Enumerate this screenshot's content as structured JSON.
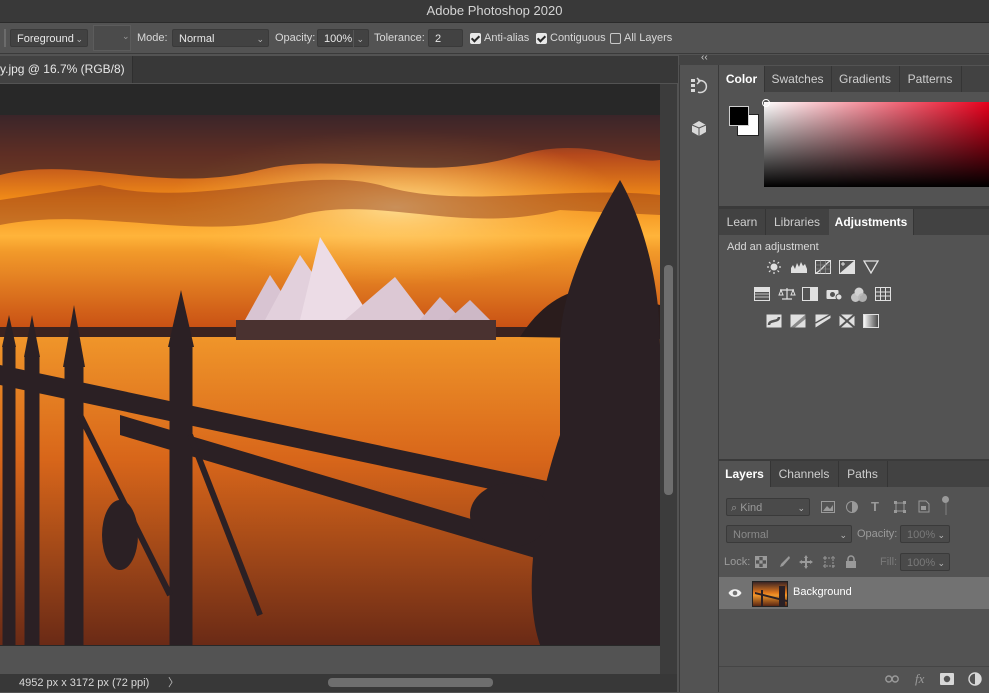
{
  "app_title": "Adobe Photoshop 2020",
  "options_bar": {
    "fill_source": "Foreground",
    "mode_label": "Mode:",
    "mode_value": "Normal",
    "opacity_label": "Opacity:",
    "opacity_value": "100%",
    "tolerance_label": "Tolerance:",
    "tolerance_value": "2",
    "anti_alias_label": "Anti-alias",
    "anti_alias_checked": true,
    "contiguous_label": "Contiguous",
    "contiguous_checked": true,
    "all_layers_label": "All Layers",
    "all_layers_checked": false
  },
  "document": {
    "tab_title": "y.jpg @ 16.7% (RGB/8)",
    "status_text": "4952 px x 3172 px (72 ppi)",
    "status_arrow": "〉"
  },
  "collapse_glyph": "‹‹",
  "color_panel": {
    "tabs": [
      "Color",
      "Swatches",
      "Gradients",
      "Patterns"
    ],
    "active_tab": "Color",
    "foreground": "#000000",
    "background": "#ffffff",
    "hue": "#e8001c"
  },
  "adjust_panel": {
    "tabs": [
      "Learn",
      "Libraries",
      "Adjustments"
    ],
    "active_tab": "Adjustments",
    "hint": "Add an adjustment",
    "icons_row1": [
      "brightness-contrast-icon",
      "levels-icon",
      "curves-icon",
      "exposure-icon",
      "gradient-triangle-icon"
    ],
    "icons_row2": [
      "vibrance-icon",
      "color-balance-icon",
      "black-white-icon",
      "photo-filter-icon",
      "channel-mixer-icon",
      "color-lookup-icon"
    ],
    "icons_row3": [
      "invert-icon",
      "posterize-icon",
      "threshold-icon",
      "selective-color-icon",
      "gradient-map-icon"
    ]
  },
  "layers_panel": {
    "tabs": [
      "Layers",
      "Channels",
      "Paths"
    ],
    "active_tab": "Layers",
    "filter_kind": "Kind",
    "blend_mode": "Normal",
    "opacity_label": "Opacity:",
    "opacity_value": "100%",
    "lock_label": "Lock:",
    "fill_label": "Fill:",
    "fill_value": "100%",
    "layers": [
      {
        "name": "Background",
        "visible": true
      }
    ],
    "footer_icons": [
      "link-layers-icon",
      "fx-icon",
      "add-mask-icon",
      "new-adjustment-icon"
    ],
    "fx_text": "fx"
  }
}
